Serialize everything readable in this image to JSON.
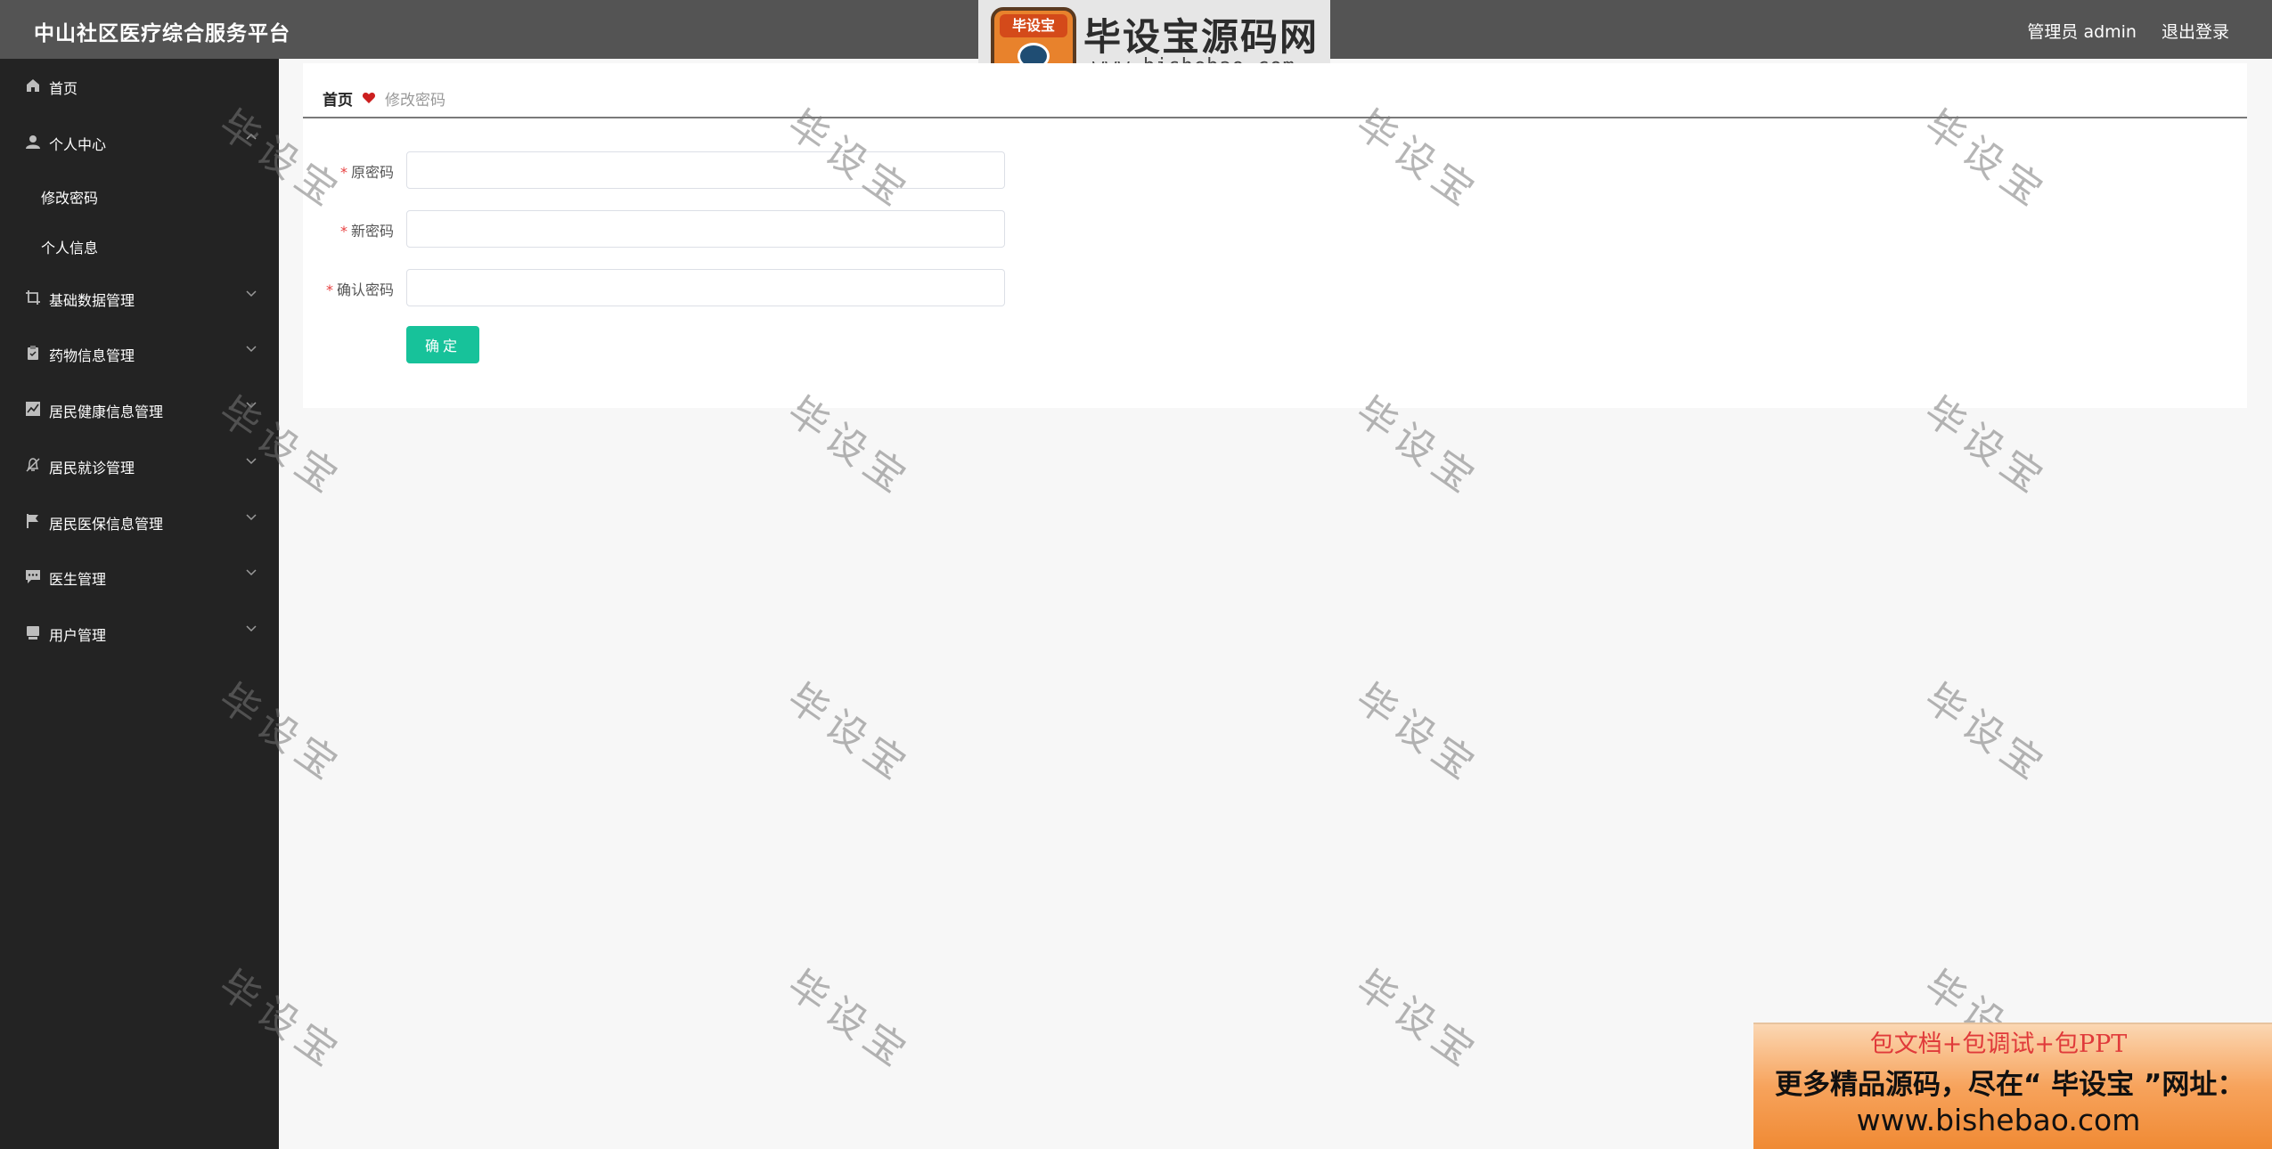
{
  "header": {
    "title": "中山社区医疗综合服务平台",
    "user_label": "管理员 admin",
    "logout_label": "退出登录"
  },
  "logo_watermark": {
    "badge_text": "毕设宝",
    "site_name": "毕设宝源码网",
    "url": "www.bishebao.com"
  },
  "sidebar": {
    "items": [
      {
        "label": "首页",
        "icon": "home-icon"
      },
      {
        "label": "个人中心",
        "icon": "user-icon",
        "expanded": true
      },
      {
        "label": "基础数据管理",
        "icon": "crop-icon"
      },
      {
        "label": "药物信息管理",
        "icon": "clipboard-icon"
      },
      {
        "label": "居民健康信息管理",
        "icon": "chart-icon"
      },
      {
        "label": "居民就诊管理",
        "icon": "bell-off-icon"
      },
      {
        "label": "居民医保信息管理",
        "icon": "flag-icon"
      },
      {
        "label": "医生管理",
        "icon": "chat-icon"
      },
      {
        "label": "用户管理",
        "icon": "bookmark-icon"
      }
    ],
    "submenu": [
      {
        "label": "修改密码"
      },
      {
        "label": "个人信息"
      }
    ]
  },
  "breadcrumb": {
    "home": "首页",
    "current": "修改密码",
    "separator_icon": "heart-icon",
    "separator_color": "#cc1f1f"
  },
  "form": {
    "fields": [
      {
        "label": "原密码",
        "value": "",
        "placeholder": ""
      },
      {
        "label": "新密码",
        "value": "",
        "placeholder": ""
      },
      {
        "label": "确认密码",
        "value": "",
        "placeholder": ""
      }
    ],
    "submit_label": "确定",
    "submit_color": "#17c29a"
  },
  "watermark_text": "毕设宝",
  "ad": {
    "line1": "包文档+包调试+包PPT",
    "line2": "更多精品源码，尽在“ 毕设宝 ”网址：",
    "line3": "www.bishebao.com"
  }
}
